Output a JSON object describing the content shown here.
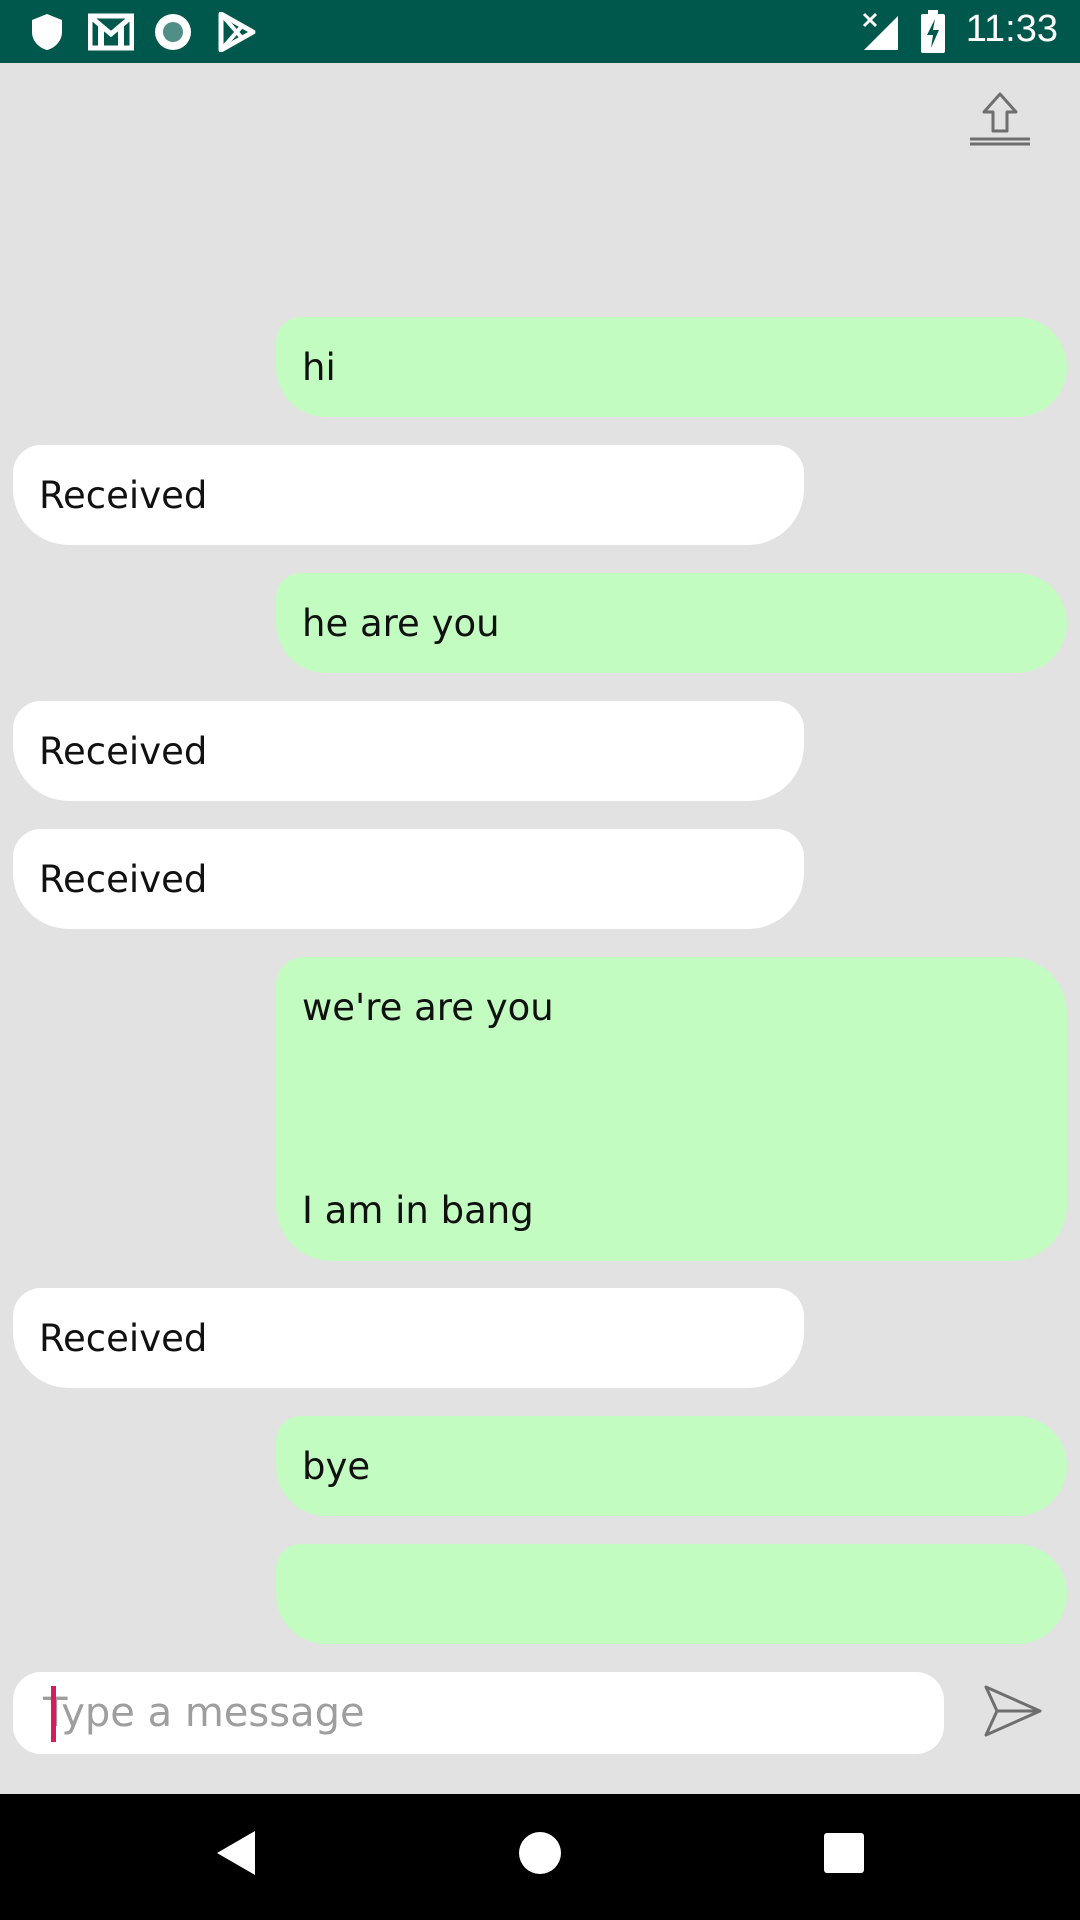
{
  "status_bar": {
    "time": "11:33",
    "left_icons": [
      "shield-icon",
      "gmail-icon",
      "record-icon",
      "play-store-icon"
    ],
    "right_icons": [
      "signal-no-service-icon",
      "battery-charging-icon"
    ],
    "background": "#00574b"
  },
  "toolbar": {
    "upload_icon": "upload-icon"
  },
  "messages": [
    {
      "type": "sent",
      "text": "hi"
    },
    {
      "type": "received",
      "text": "Received"
    },
    {
      "type": "sent",
      "text": "he are you"
    },
    {
      "type": "received",
      "text": "Received"
    },
    {
      "type": "received",
      "text": "Received"
    },
    {
      "type": "sent",
      "lines": [
        "we're are you",
        "I am in bang"
      ]
    },
    {
      "type": "received",
      "text": "Received"
    },
    {
      "type": "sent",
      "text": "bye"
    },
    {
      "type": "sent",
      "text": ""
    }
  ],
  "composer": {
    "placeholder": "Type a message",
    "value": "",
    "send_icon": "send-icon"
  },
  "colors": {
    "sent_bubble": "#c2fcc0",
    "received_bubble": "#ffffff",
    "background": "#e2e2e2",
    "cursor": "#d81b60"
  }
}
